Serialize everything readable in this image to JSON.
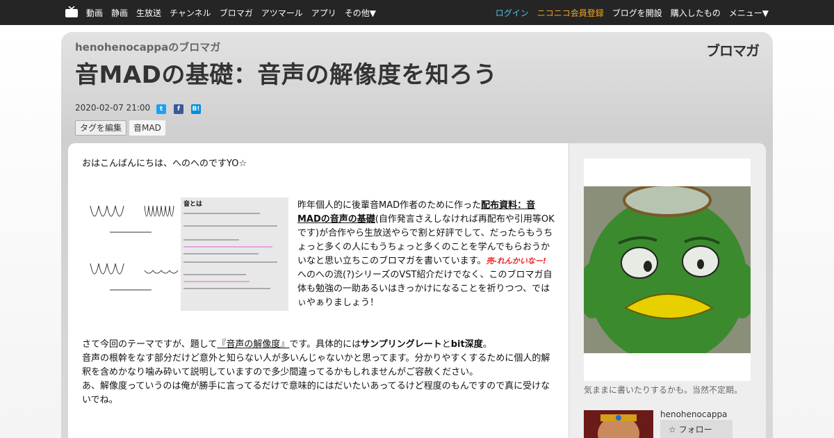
{
  "nav": {
    "left": [
      "動画",
      "静画",
      "生放送",
      "チャンネル",
      "ブロマガ",
      "アツマール",
      "アプリ",
      "その他▼"
    ],
    "right": [
      "ログイン",
      "ニコニコ会員登録",
      "ブログを開設",
      "購入したもの",
      "メニュー▼"
    ]
  },
  "header": {
    "blog_name": "henohenocappaのブロマガ",
    "title": "音MADの基礎：音声の解像度を知ろう",
    "logo": "ブロマガ",
    "date": "2020-02-07 21:00",
    "tag_edit": "タグを編集",
    "tag": "音MAD"
  },
  "article": {
    "greeting": "おはこんばんにちは、へのへのですYO☆",
    "thumb_title": "音とは",
    "side_text_1": "昨年個人的に後輩音MAD作者のために作った",
    "side_link": "配布資料：音MADの音声の基礎",
    "side_text_2": "(自作発言さえしなければ再配布や引用等OKです)が合作やら生放送やらで割と好評でして、だったらもうちょっと多くの人にもうちょっと多くのことを学んでもらおうかいなと思い立ちこのブロマガを書いています。",
    "side_red": "売-れんかいなー!",
    "side_text_3": "へのへの流(?)シリーズのVST紹介だけでなく、このブロマガ自体も勉強の一助あるいはきっかけになることを祈りつつ、ではぃやぁりましょう！",
    "p2_a": "さて今回のテーマですが、題して",
    "p2_topic": "『音声の解像度』",
    "p2_b": "です。具体的には",
    "p2_term1": "サンプリングレート",
    "p2_and": "と",
    "p2_term2": "bit深度",
    "p2_end": "。",
    "p3": "音声の根幹をなす部分だけど意外と知らない人が多いんじゃないかと思ってます。分かりやすくするために個人的解釈を含めかなり噛み砕いて説明していますので多少間違ってるかもしれませんがご容赦ください。",
    "p4": "あ、解像度っていうのは俺が勝手に言ってるだけで意味的にはだいたいあってるけど程度のもんですので真に受けないでね。"
  },
  "sidebar": {
    "description": "気ままに書いたりするかも。当然不定期。",
    "username": "henohenocappa",
    "follow": "フォロー"
  },
  "colors": {
    "nav_bg": "#252525",
    "login": "#4fc3f7",
    "register": "#f5a623",
    "accent_red": "#e22222"
  }
}
